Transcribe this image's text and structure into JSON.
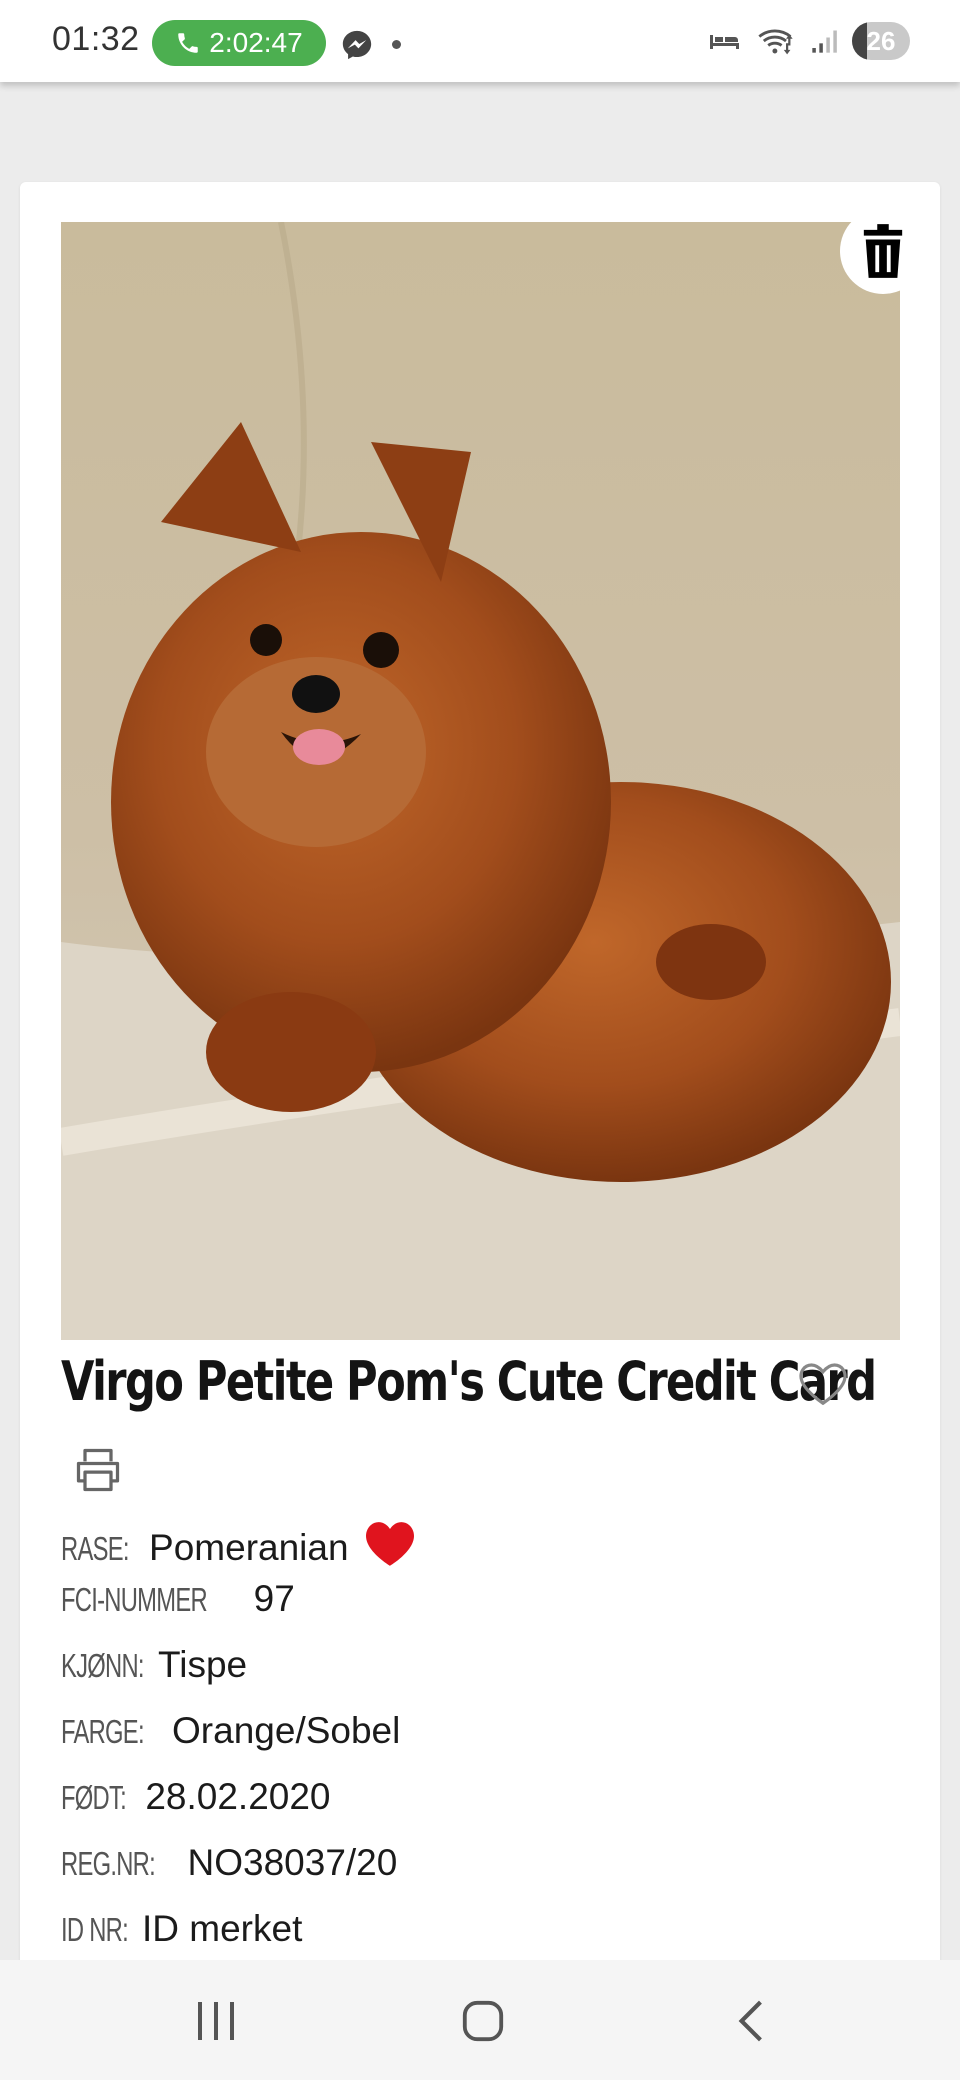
{
  "status_bar": {
    "time": "01:32",
    "call_duration": "2:02:47",
    "battery_level": "26",
    "icons": [
      "phone-icon",
      "messenger-icon",
      "sleep-icon",
      "wifi-icon",
      "signal-icon",
      "battery-icon"
    ]
  },
  "dog": {
    "photo_alt": "Pomeranian dog photo",
    "name": "Virgo Petite Pom's Cute Credit Card",
    "favorite": false
  },
  "info": [
    {
      "label": "RASE:",
      "value": "Pomeranian"
    },
    {
      "label": "FCI-NUMMER",
      "value": "97"
    },
    {
      "label": "KJØNN:",
      "value": "Tispe"
    },
    {
      "label": "FARGE:",
      "value": "Orange/Sobel"
    },
    {
      "label": "FØDT:",
      "value": "28.02.2020"
    },
    {
      "label": "REG.NR:",
      "value": "NO38037/20"
    },
    {
      "label": "ID NR:",
      "value": "ID merket"
    }
  ],
  "colors": {
    "call_green": "#4caf50",
    "heart_red": "#e0141e",
    "background": "#ececec"
  },
  "nav": [
    "recents-icon",
    "home-icon",
    "back-icon"
  ]
}
